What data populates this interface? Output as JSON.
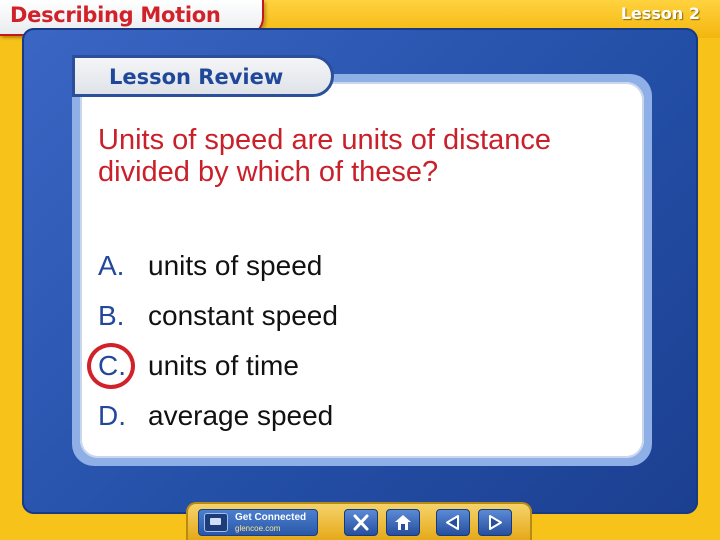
{
  "header": {
    "title": "Describing Motion",
    "lesson": "Lesson 2"
  },
  "review": {
    "label": "Lesson Review"
  },
  "question": {
    "text": "Units of speed are units of distance divided by which of these?",
    "answers": [
      {
        "letter": "A.",
        "text": "units of speed",
        "selected": false
      },
      {
        "letter": "B.",
        "text": "constant speed",
        "selected": false
      },
      {
        "letter": "C.",
        "text": "units of time",
        "selected": true
      },
      {
        "letter": "D.",
        "text": "average speed",
        "selected": false
      }
    ]
  },
  "nav": {
    "get_connected": "Get Connected",
    "site": "glencoe.com",
    "buttons": [
      "close-icon",
      "home-icon",
      "previous-icon",
      "next-icon"
    ]
  },
  "colors": {
    "background": "#f7c21a",
    "frame": "#2450a8",
    "title_red": "#d1222a",
    "answer_letter": "#23489a",
    "highlight": "#d1222a"
  }
}
